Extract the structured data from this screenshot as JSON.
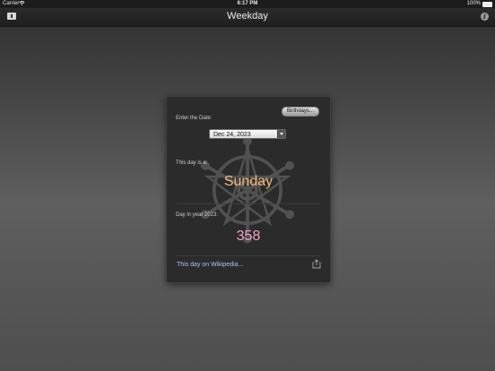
{
  "status_bar": {
    "carrier": "Carrier",
    "time": "6:17 PM",
    "battery": "100%"
  },
  "nav_bar": {
    "title": "Weekday",
    "left_icon": "book-icon",
    "right_icon": "info-icon",
    "info_glyph": "i"
  },
  "panel": {
    "birthdays_label": "Birthdays...",
    "enter_date_label": "Enter the Date:",
    "date_value": "Dec 24, 2023",
    "this_day_is_label": "This day is a:",
    "weekday": "Sunday",
    "day_in_year_label": "Day in year 2023:",
    "day_number": "358",
    "wikipedia_link": "This day on Wikipedia...",
    "share_icon": "share-icon"
  },
  "colors": {
    "weekday": "#f3b97c",
    "day_number": "#f5a2c4",
    "link": "#a9c6ee"
  }
}
